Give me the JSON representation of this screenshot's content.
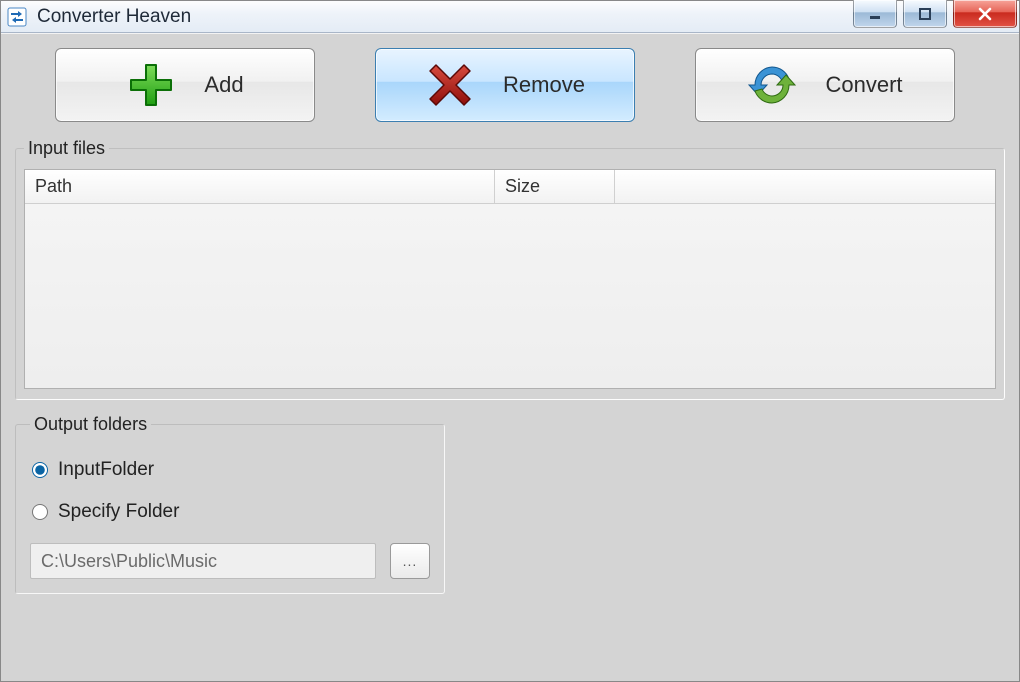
{
  "window": {
    "title": "Converter Heaven"
  },
  "toolbar": {
    "add_label": "Add",
    "remove_label": "Remove",
    "convert_label": "Convert",
    "active": "remove"
  },
  "input_files": {
    "legend": "Input files",
    "columns": {
      "path": "Path",
      "size": "Size"
    },
    "rows": []
  },
  "output": {
    "legend": "Output folders",
    "radios": {
      "input_folder_label": "InputFolder",
      "specify_folder_label": "Specify Folder",
      "selected": "input_folder"
    },
    "path_value": "C:\\Users\\Public\\Music",
    "browse_label": "..."
  }
}
